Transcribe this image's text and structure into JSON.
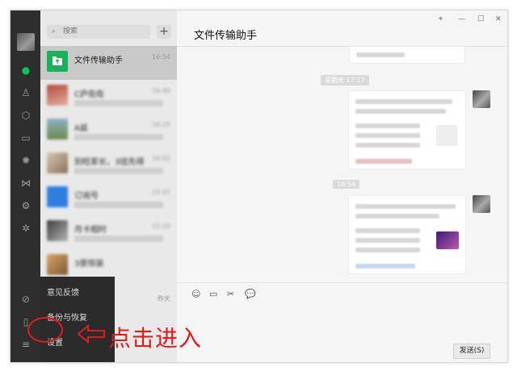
{
  "window": {
    "controls": [
      "⌖",
      "—",
      "☐",
      "✕"
    ]
  },
  "search": {
    "placeholder": "搜索",
    "icon": "search-icon"
  },
  "conversations": [
    {
      "name": "文件传输助手",
      "time": "16:54",
      "selected": true
    },
    {
      "name": "C庐佐佐",
      "time": "16:40",
      "blurred": true
    },
    {
      "name": "A兹",
      "time": "16:25",
      "blurred": true
    },
    {
      "name": "别旺家长，3班先得",
      "time": "16:02",
      "blurred": true
    },
    {
      "name": "订阅号",
      "time": "15:47",
      "blurred": true
    },
    {
      "name": "月卡相时",
      "time": "15:20",
      "blurred": true
    },
    {
      "name": "3景惊装",
      "time": "昨天",
      "blurred": true
    }
  ],
  "chat": {
    "title": "文件传输助手",
    "stamps": [
      "星期天 17:17",
      "16:54"
    ]
  },
  "toolbar": {
    "send_label": "发送(S)"
  },
  "menu": {
    "items": [
      "意见反馈",
      "备份与恢复",
      "设置"
    ]
  },
  "annotation": {
    "text": "点击进入",
    "color": "#e21b1b"
  },
  "colors": {
    "accent": "#07c160",
    "sidebar": "#2e2e2e"
  }
}
